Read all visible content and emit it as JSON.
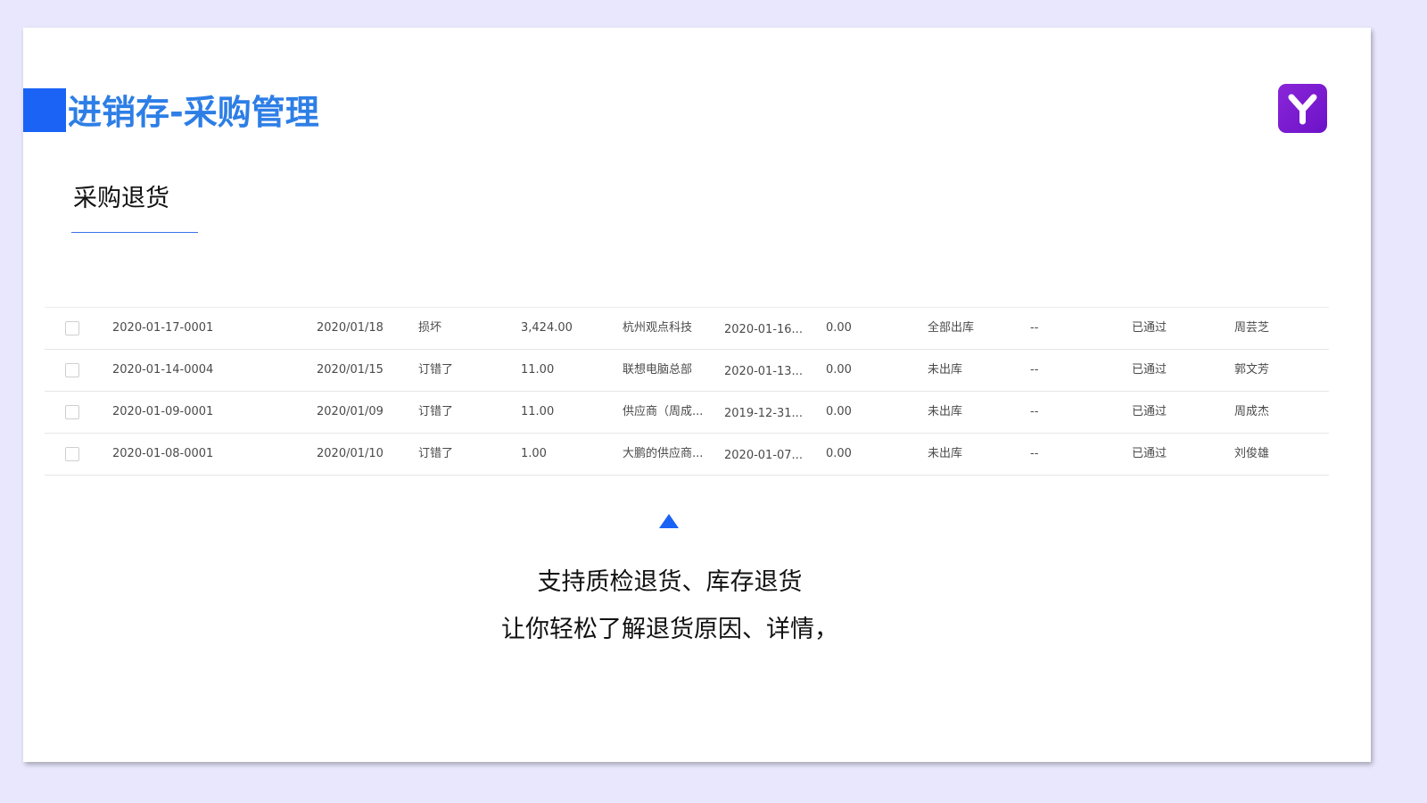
{
  "header": {
    "title": "进销存-采购管理",
    "accent_color": "#1a63f5",
    "logo_icon": "y-logo-icon"
  },
  "section": {
    "title": "采购退货"
  },
  "table": {
    "rows": [
      {
        "code": "2020-01-17-0001",
        "date": "2020/01/18",
        "reason": "损坏",
        "amount": "3,424.00",
        "supplier": "杭州观点科技",
        "return_date": "2020-01-16...",
        "value": "0.00",
        "stock_status": "全部出库",
        "note": "--",
        "approval": "已通过",
        "person": "周芸芝"
      },
      {
        "code": "2020-01-14-0004",
        "date": "2020/01/15",
        "reason": "订错了",
        "amount": "11.00",
        "supplier": "联想电脑总部",
        "return_date": "2020-01-13...",
        "value": "0.00",
        "stock_status": "未出库",
        "note": "--",
        "approval": "已通过",
        "person": "郭文芳"
      },
      {
        "code": "2020-01-09-0001",
        "date": "2020/01/09",
        "reason": "订错了",
        "amount": "11.00",
        "supplier": "供应商（周成...",
        "return_date": "2019-12-31...",
        "value": "0.00",
        "stock_status": "未出库",
        "note": "--",
        "approval": "已通过",
        "person": "周成杰"
      },
      {
        "code": "2020-01-08-0001",
        "date": "2020/01/10",
        "reason": "订错了",
        "amount": "1.00",
        "supplier": "大鹏的供应商...",
        "return_date": "2020-01-07...",
        "value": "0.00",
        "stock_status": "未出库",
        "note": "--",
        "approval": "已通过",
        "person": "刘俊雄"
      }
    ]
  },
  "caption": {
    "line1": "支持质检退货、库存退货",
    "line2": "让你轻松了解退货原因、详情，"
  }
}
